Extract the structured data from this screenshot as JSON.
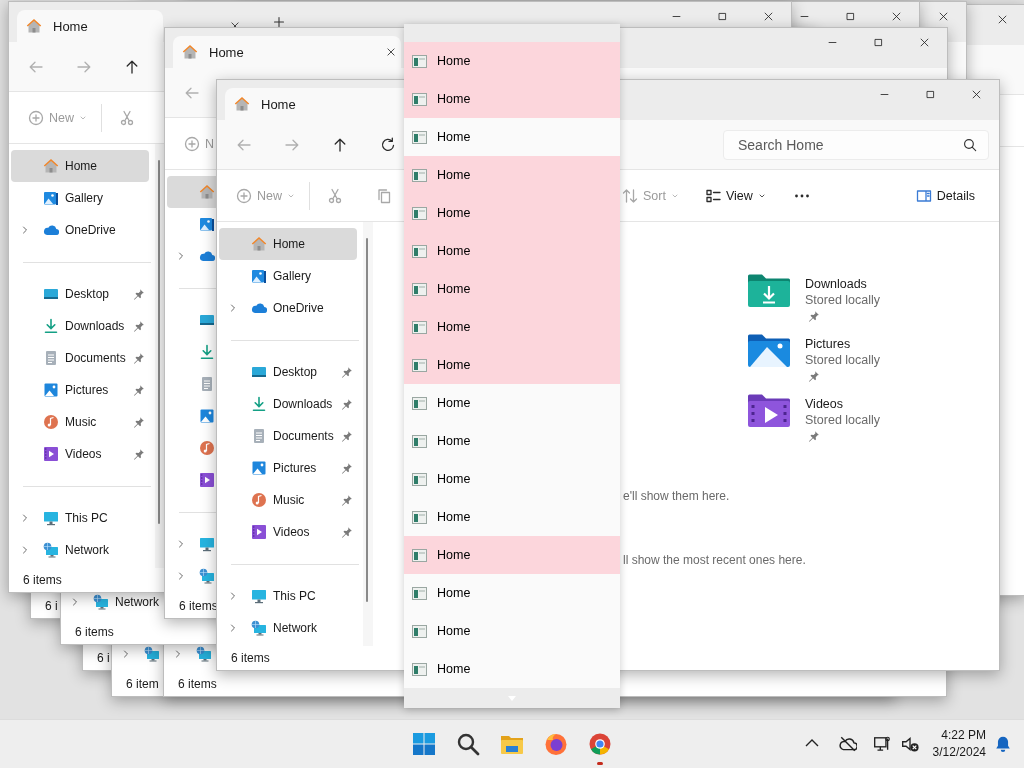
{
  "windows": [
    {
      "tab": {
        "title": "Home",
        "closable": false
      },
      "controls": [
        {
          "kind": "minimize"
        },
        {
          "kind": "maximize"
        },
        {
          "kind": "close"
        }
      ],
      "nav": [
        {
          "kind": "back",
          "disabled": true
        },
        {
          "kind": "forward",
          "disabled": true
        },
        {
          "kind": "up",
          "disabled": false
        },
        {
          "kind": "refresh",
          "disabled": false
        }
      ],
      "search": {
        "placeholder": "Search Home"
      },
      "toolbar": [
        {
          "kind": "new",
          "label": "New",
          "menu": true,
          "disabled": true
        },
        {
          "kind": "cut",
          "disabled": true
        },
        {
          "kind": "copy",
          "disabled": true
        },
        {
          "kind": "sort",
          "label": "Sort",
          "menu": true,
          "disabled": true
        },
        {
          "kind": "view",
          "label": "View",
          "menu": true,
          "disabled": false
        },
        {
          "kind": "more",
          "disabled": false
        },
        {
          "kind": "details",
          "label": "Details",
          "disabled": false
        }
      ],
      "sidebar": {
        "top": [
          {
            "kind": "home",
            "label": "Home",
            "selected": true,
            "expandable": false
          },
          {
            "kind": "gallery",
            "label": "Gallery",
            "selected": false,
            "expandable": false
          },
          {
            "kind": "onedrive",
            "label": "OneDrive",
            "selected": false,
            "expandable": true
          }
        ],
        "pinned": [
          {
            "kind": "desktop",
            "label": "Desktop",
            "selected": false,
            "pinned": true
          },
          {
            "kind": "downloads",
            "label": "Downloads",
            "selected": false,
            "pinned": true
          },
          {
            "kind": "documents",
            "label": "Documents",
            "selected": false,
            "pinned": true
          },
          {
            "kind": "pictures",
            "label": "Pictures",
            "selected": false,
            "pinned": true
          },
          {
            "kind": "music",
            "label": "Music",
            "selected": false,
            "pinned": true
          },
          {
            "kind": "videos",
            "label": "Videos",
            "selected": false,
            "pinned": true
          }
        ],
        "devices": [
          {
            "kind": "thispc",
            "label": "This PC",
            "selected": false,
            "expandable": true
          },
          {
            "kind": "network",
            "label": "Network",
            "selected": false,
            "expandable": true
          }
        ]
      },
      "quick_access": [
        {
          "kind": "downloads",
          "name": "Downloads",
          "detail": "Stored locally",
          "pinned": true
        },
        {
          "kind": "pictures",
          "name": "Pictures",
          "detail": "Stored locally",
          "pinned": true
        },
        {
          "kind": "videos",
          "name": "Videos",
          "detail": "Stored locally",
          "pinned": true
        }
      ],
      "notes": [
        "e'll show them here.",
        "ll show the most recent ones here."
      ],
      "status": "6 items"
    },
    {
      "tab": {
        "title": "Home",
        "closable": true
      },
      "controls": [
        {
          "kind": "minimize"
        },
        {
          "kind": "maximize"
        },
        {
          "kind": "close"
        }
      ],
      "nav": [
        {
          "kind": "back",
          "disabled": true
        }
      ],
      "toolbar": [
        {
          "kind": "new",
          "label": "N",
          "menu": false,
          "disabled": true
        }
      ],
      "sidebar": {
        "top": [
          {
            "kind": "home",
            "selected": true,
            "expandable": false
          },
          {
            "kind": "gallery",
            "selected": false,
            "expandable": false
          },
          {
            "kind": "onedrive",
            "selected": false,
            "expandable": true
          }
        ],
        "pinned": [
          {
            "kind": "desktop",
            "selected": false
          },
          {
            "kind": "downloads",
            "selected": false
          },
          {
            "kind": "documents",
            "selected": false
          },
          {
            "kind": "pictures",
            "selected": false
          },
          {
            "kind": "music",
            "selected": false
          },
          {
            "kind": "videos",
            "selected": false
          }
        ],
        "devices": [
          {
            "kind": "thispc",
            "selected": false,
            "expandable": true
          },
          {
            "kind": "network",
            "selected": false,
            "expandable": true
          }
        ]
      },
      "status": "6 items"
    },
    {
      "tab": {
        "title": "Home",
        "closable": true
      },
      "new_tab": true,
      "controls": [
        {
          "kind": "minimize"
        },
        {
          "kind": "maximize"
        },
        {
          "kind": "close"
        }
      ],
      "nav": [
        {
          "kind": "back",
          "disabled": true
        },
        {
          "kind": "forward",
          "disabled": true
        },
        {
          "kind": "up",
          "disabled": false
        }
      ],
      "toolbar": [
        {
          "kind": "new",
          "label": "New",
          "menu": true,
          "disabled": true
        },
        {
          "kind": "cut",
          "disabled": true
        }
      ],
      "sidebar": {
        "top": [
          {
            "kind": "home",
            "label": "Home",
            "selected": true,
            "expandable": false
          },
          {
            "kind": "gallery",
            "label": "Gallery",
            "selected": false,
            "expandable": false
          },
          {
            "kind": "onedrive",
            "label": "OneDrive",
            "selected": false,
            "expandable": true
          }
        ],
        "pinned": [
          {
            "kind": "desktop",
            "label": "Desktop",
            "selected": false,
            "pinned": true
          },
          {
            "kind": "downloads",
            "label": "Downloads",
            "selected": false,
            "pinned": true
          },
          {
            "kind": "documents",
            "label": "Documents",
            "selected": false,
            "pinned": true
          },
          {
            "kind": "pictures",
            "label": "Pictures",
            "selected": false,
            "pinned": true
          },
          {
            "kind": "music",
            "label": "Music",
            "selected": false,
            "pinned": true
          },
          {
            "kind": "videos",
            "label": "Videos",
            "selected": false,
            "pinned": true
          }
        ],
        "devices": [
          {
            "kind": "thispc",
            "label": "This PC",
            "selected": false,
            "expandable": true
          },
          {
            "kind": "network",
            "label": "Network",
            "selected": false,
            "expandable": true
          }
        ]
      },
      "status": "6 items"
    },
    {
      "sidebar": {
        "devices": [
          {
            "kind": "network",
            "label": "Network",
            "expandable": true
          }
        ]
      },
      "status": "6 items"
    },
    {
      "sidebar": {
        "devices": [
          {
            "kind": "network",
            "expandable": true
          }
        ]
      },
      "status": "6 items"
    },
    {
      "sidebar": {
        "devices": [
          {
            "kind": "network",
            "expandable": true
          }
        ]
      },
      "status": "6 item"
    },
    {
      "status": "6 i"
    },
    {
      "status": "6 i"
    },
    {
      "controls": [
        {
          "kind": "minimize"
        },
        {
          "kind": "maximize"
        },
        {
          "kind": "close"
        }
      ]
    },
    {
      "controls": [
        {
          "kind": "close"
        }
      ]
    },
    {
      "controls": [
        {
          "kind": "close"
        }
      ]
    }
  ],
  "popup": {
    "items": [
      {
        "label": "Home",
        "highlighted": true
      },
      {
        "label": "Home",
        "highlighted": true
      },
      {
        "label": "Home",
        "highlighted": false
      },
      {
        "label": "Home",
        "highlighted": true
      },
      {
        "label": "Home",
        "highlighted": true
      },
      {
        "label": "Home",
        "highlighted": true
      },
      {
        "label": "Home",
        "highlighted": true
      },
      {
        "label": "Home",
        "highlighted": true
      },
      {
        "label": "Home",
        "highlighted": true
      },
      {
        "label": "Home",
        "highlighted": false
      },
      {
        "label": "Home",
        "highlighted": false
      },
      {
        "label": "Home",
        "highlighted": false
      },
      {
        "label": "Home",
        "highlighted": false
      },
      {
        "label": "Home",
        "highlighted": true
      },
      {
        "label": "Home",
        "highlighted": false
      },
      {
        "label": "Home",
        "highlighted": false
      },
      {
        "label": "Home",
        "highlighted": false
      }
    ]
  },
  "taskbar": {
    "apps": [
      {
        "kind": "start",
        "attention": false
      },
      {
        "kind": "search",
        "attention": false
      },
      {
        "kind": "explorer",
        "attention": false
      },
      {
        "kind": "firefox",
        "attention": false
      },
      {
        "kind": "chrome",
        "attention": true
      }
    ],
    "tray": [
      {
        "kind": "chevron"
      },
      {
        "kind": "cloud-off"
      },
      {
        "kind": "network"
      },
      {
        "kind": "volume-muted"
      }
    ],
    "clock": {
      "time": "4:22 PM",
      "date": "3/12/2024"
    }
  }
}
